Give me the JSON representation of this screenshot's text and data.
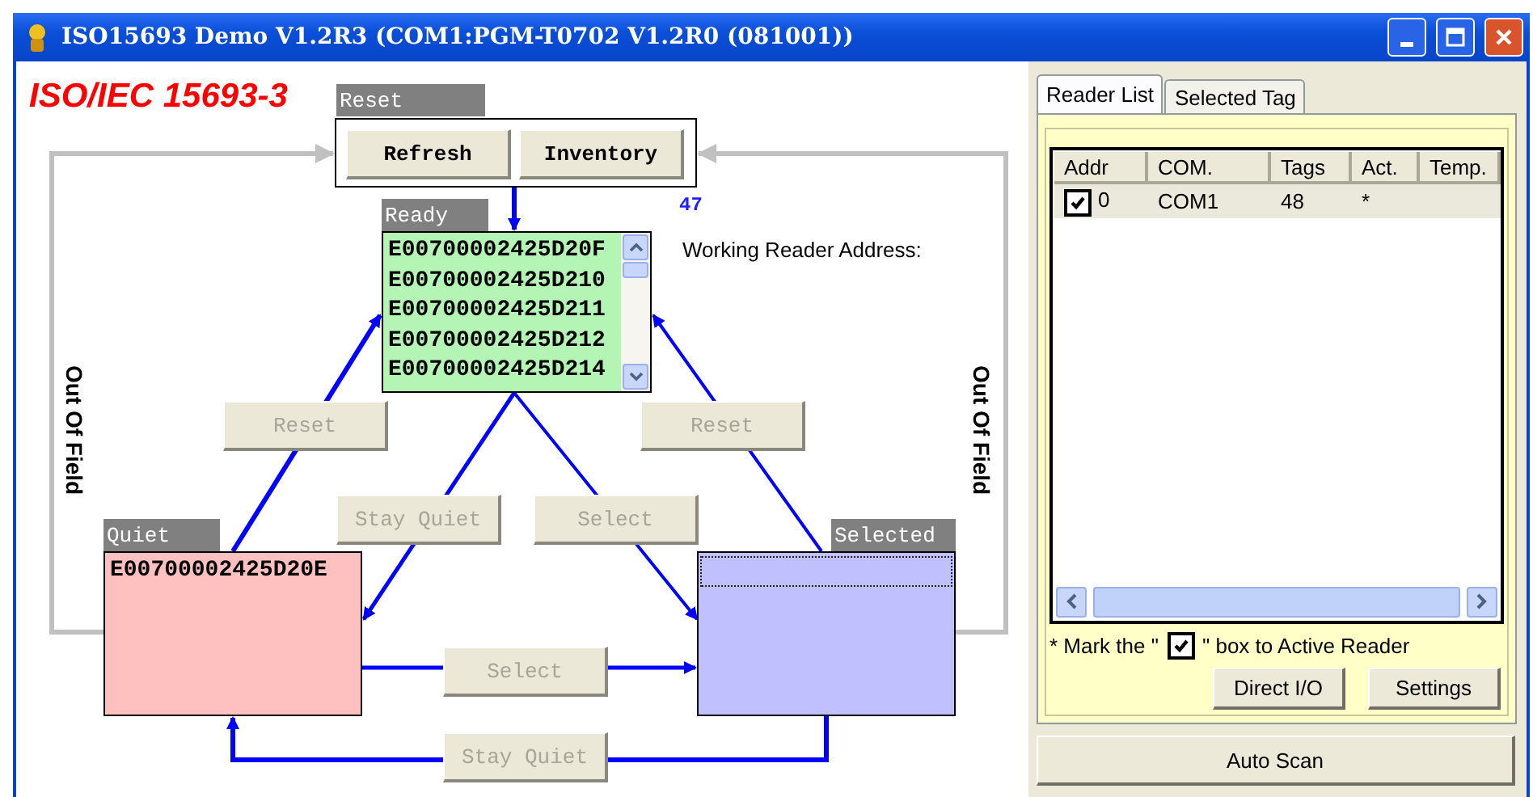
{
  "window": {
    "title": "ISO15693 Demo V1.2R3 (COM1:PGM-T0702 V1.2R0 (081001))"
  },
  "diagram": {
    "heading": "ISO/IEC 15693-3",
    "reset_group": {
      "label": "Reset",
      "buttons": [
        {
          "label": "Refresh",
          "disabled": false
        },
        {
          "label": "Inventory",
          "disabled": false
        }
      ]
    },
    "side_labels": [
      "Out Of Field",
      "Out Of Field"
    ],
    "ready": {
      "label": "Ready",
      "count": "47",
      "tags": [
        "E00700002425D20F",
        "E00700002425D210",
        "E00700002425D211",
        "E00700002425D212",
        "E00700002425D214"
      ]
    },
    "quiet": {
      "label": "Quiet",
      "tags": [
        "E00700002425D20E"
      ]
    },
    "selected": {
      "label": "Selected"
    },
    "transitions": [
      {
        "label": "Reset",
        "disabled": true
      },
      {
        "label": "Reset",
        "disabled": true
      },
      {
        "label": "Stay Quiet",
        "disabled": true
      },
      {
        "label": "Select",
        "disabled": true
      },
      {
        "label": "Select",
        "disabled": true
      },
      {
        "label": "Stay Quiet",
        "disabled": true
      }
    ],
    "working_reader_address": "Working Reader Address:"
  },
  "tabs": [
    {
      "label": "Reader List",
      "selected": true
    },
    {
      "label": "Selected Tag",
      "selected": false
    }
  ],
  "reader_table": {
    "columns": [
      "Addr",
      "COM.",
      "Tags",
      "Act.",
      "Temp."
    ],
    "rows": [
      {
        "checked": true,
        "selected": true,
        "cells": [
          "0",
          "COM1",
          "48",
          "*",
          ""
        ]
      }
    ]
  },
  "note": {
    "before": "* Mark the \"",
    "checked": true,
    "after": "\" box to Active Reader"
  },
  "buttons": [
    {
      "label": "Direct I/O"
    },
    {
      "label": "Settings"
    }
  ],
  "auto_scan": {
    "label": "Auto Scan"
  }
}
